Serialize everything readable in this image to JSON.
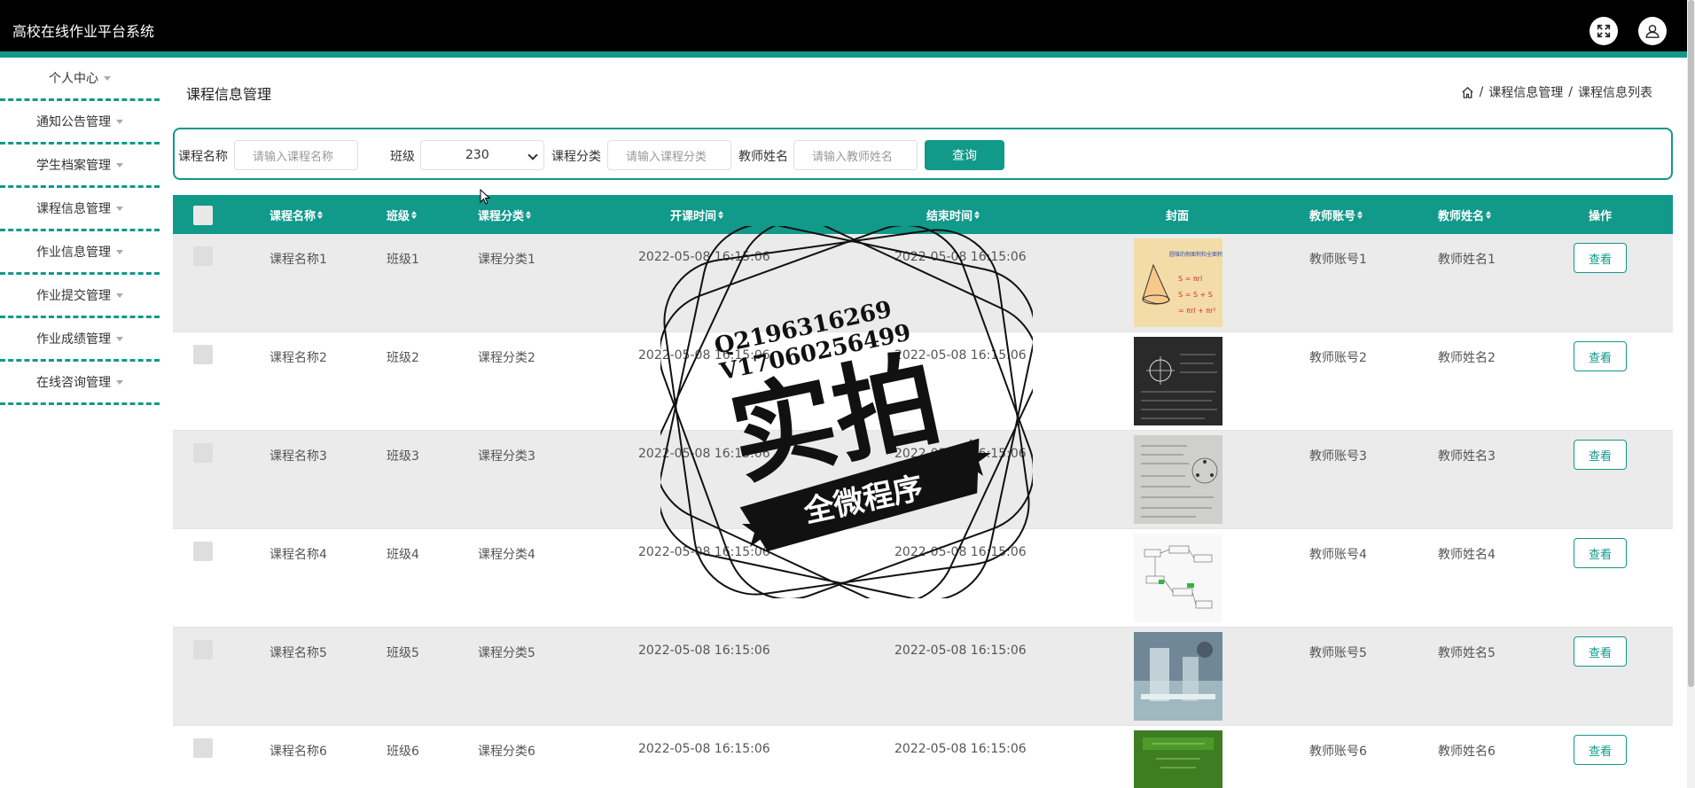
{
  "header": {
    "app_title": "高校在线作业平台系统"
  },
  "sidebar": {
    "items": [
      {
        "label": "个人中心"
      },
      {
        "label": "通知公告管理"
      },
      {
        "label": "学生档案管理"
      },
      {
        "label": "课程信息管理"
      },
      {
        "label": "作业信息管理"
      },
      {
        "label": "作业提交管理"
      },
      {
        "label": "作业成绩管理"
      },
      {
        "label": "在线咨询管理"
      }
    ]
  },
  "main": {
    "page_title": "课程信息管理",
    "breadcrumb": {
      "items": [
        "课程信息管理",
        "课程信息列表"
      ],
      "separator": "/"
    }
  },
  "search": {
    "course_name_label": "课程名称",
    "course_name_placeholder": "请输入课程名称",
    "class_label": "班级",
    "class_value": "230",
    "category_label": "课程分类",
    "category_placeholder": "请输入课程分类",
    "teacher_label": "教师姓名",
    "teacher_placeholder": "请输入教师姓名",
    "query_label": "查询"
  },
  "table": {
    "columns": [
      "课程名称",
      "班级",
      "课程分类",
      "开课时间",
      "结束时间",
      "封面",
      "教师账号",
      "教师姓名",
      "操作"
    ],
    "rows": [
      {
        "name": "课程名称1",
        "class": "班级1",
        "category": "课程分类1",
        "start": "2022-05-08 16:15:06",
        "end": "2022-05-08 16:15:06",
        "account": "教师账号1",
        "teacher": "教师姓名1",
        "action": "查看"
      },
      {
        "name": "课程名称2",
        "class": "班级2",
        "category": "课程分类2",
        "start": "2022-05-08 16:15:06",
        "end": "2022-05-08 16:15:06",
        "account": "教师账号2",
        "teacher": "教师姓名2",
        "action": "查看"
      },
      {
        "name": "课程名称3",
        "class": "班级3",
        "category": "课程分类3",
        "start": "2022-05-08 16:15:06",
        "end": "2022-05-08 16:15:06",
        "account": "教师账号3",
        "teacher": "教师姓名3",
        "action": "查看"
      },
      {
        "name": "课程名称4",
        "class": "班级4",
        "category": "课程分类4",
        "start": "2022-05-08 16:15:06",
        "end": "2022-05-08 16:15:06",
        "account": "教师账号4",
        "teacher": "教师姓名4",
        "action": "查看"
      },
      {
        "name": "课程名称5",
        "class": "班级5",
        "category": "课程分类5",
        "start": "2022-05-08 16:15:06",
        "end": "2022-05-08 16:15:06",
        "account": "教师账号5",
        "teacher": "教师姓名5",
        "action": "查看"
      },
      {
        "name": "课程名称6",
        "class": "班级6",
        "category": "课程分类6",
        "start": "2022-05-08 16:15:06",
        "end": "2022-05-08 16:15:06",
        "account": "教师账号6",
        "teacher": "教师姓名6",
        "action": "查看"
      }
    ]
  },
  "watermark": {
    "line1": "Q2196316269",
    "line2": "V17060256499",
    "big_text": "实拍",
    "ribbon_text": "全微程序"
  },
  "colors": {
    "accent": "#11998a",
    "topbar": "#000000",
    "row_stripe": "#ebebeb"
  },
  "icons": {
    "fullscreen": "fullscreen-icon",
    "user": "user-icon",
    "home": "home-icon"
  }
}
